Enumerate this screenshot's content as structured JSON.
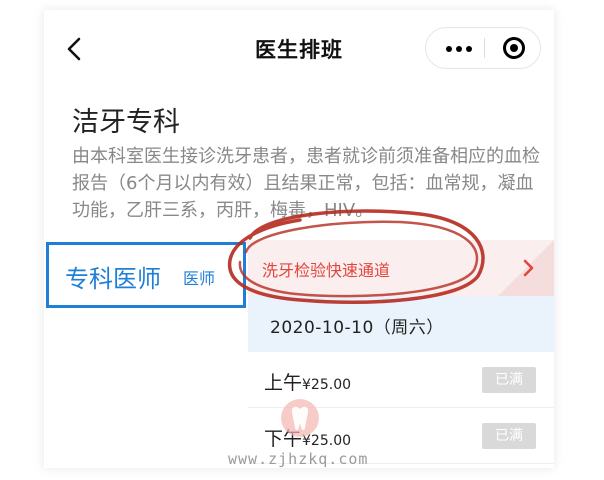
{
  "nav": {
    "title": "医生排班"
  },
  "department": {
    "name": "洁牙专科",
    "description": "由本科室医生接诊洗牙患者，患者就诊前须准备相应的血检报告（6个月以内有效）且结果正常，包括：血常规，凝血功能，乙肝三系，丙肝，梅毒，HIV。"
  },
  "doctor_type": {
    "main_label": "专科医师",
    "sub_label": "医师"
  },
  "schedule": {
    "fast_channel_label": "洗牙检验快速通道",
    "date": "2020-10-10（周六）",
    "slots": [
      {
        "period": "上午",
        "price": "¥25.00",
        "status": "已满"
      },
      {
        "period": "下午",
        "price": "¥25.00",
        "status": "已满"
      }
    ]
  },
  "watermark": "www.zjhzkq.com",
  "colors": {
    "accent_blue": "#1f7fd6",
    "fast_channel_red": "#e0463c",
    "annotation_red": "#b52a1f",
    "disabled_badge": "#d9d9d9"
  },
  "icons": [
    "back-arrow-icon",
    "more-dots-icon",
    "close-mini-program-icon",
    "chevron-right-icon",
    "tooth-logo-icon"
  ]
}
